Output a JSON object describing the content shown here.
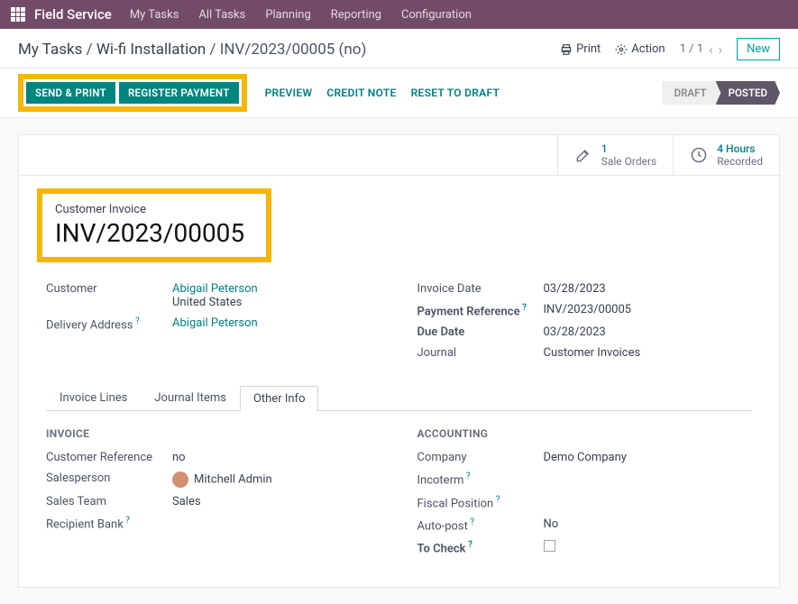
{
  "topbar": {
    "brand": "Field Service",
    "menu": [
      "My Tasks",
      "All Tasks",
      "Planning",
      "Reporting",
      "Configuration"
    ]
  },
  "breadcrumb": {
    "a": "My Tasks",
    "b": "Wi-fi Installation",
    "c": "INV/2023/00005 (no)"
  },
  "header_actions": {
    "print": "Print",
    "action": "Action",
    "pager": "1 / 1",
    "new": "New"
  },
  "buttons": {
    "send_print": "SEND & PRINT",
    "register_payment": "REGISTER PAYMENT",
    "preview": "PREVIEW",
    "credit_note": "CREDIT NOTE",
    "reset": "RESET TO DRAFT"
  },
  "status": {
    "draft": "DRAFT",
    "posted": "POSTED"
  },
  "statbuttons": {
    "sale_orders": {
      "num": "1",
      "label": "Sale Orders"
    },
    "hours": {
      "num": "4 Hours",
      "label": "Recorded"
    }
  },
  "title": {
    "sup": "Customer Invoice",
    "big": "INV/2023/00005"
  },
  "left_fields": {
    "customer_l": "Customer",
    "customer_v": "Abigail Peterson",
    "customer_sub": "United States",
    "delivery_l": "Delivery Address",
    "delivery_v": "Abigail Peterson"
  },
  "right_fields": {
    "invdate_l": "Invoice Date",
    "invdate_v": "03/28/2023",
    "payref_l": "Payment Reference",
    "payref_v": "INV/2023/00005",
    "due_l": "Due Date",
    "due_v": "03/28/2023",
    "journal_l": "Journal",
    "journal_v": "Customer Invoices"
  },
  "tabs": {
    "a": "Invoice Lines",
    "b": "Journal Items",
    "c": "Other Info"
  },
  "invoice_section": {
    "title": "INVOICE",
    "custref_l": "Customer Reference",
    "custref_v": "no",
    "sales_l": "Salesperson",
    "sales_v": "Mitchell Admin",
    "team_l": "Sales Team",
    "team_v": "Sales",
    "bank_l": "Recipient Bank"
  },
  "acct_section": {
    "title": "ACCOUNTING",
    "company_l": "Company",
    "company_v": "Demo Company",
    "incoterm_l": "Incoterm",
    "fiscal_l": "Fiscal Position",
    "autopost_l": "Auto-post",
    "autopost_v": "No",
    "tocheck_l": "To Check"
  }
}
